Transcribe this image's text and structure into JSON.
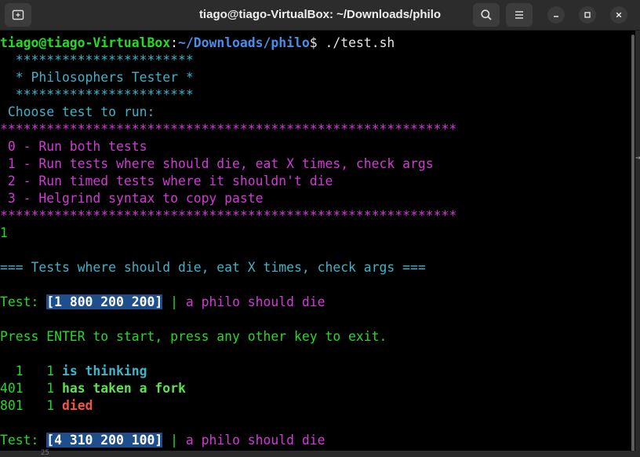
{
  "window": {
    "title": "tiago@tiago-VirtualBox: ~/Downloads/philo",
    "icons": {
      "new_tab": "new-tab-icon",
      "search": "search-icon",
      "menu": "hamburger-menu-icon",
      "minimize": "minimize-icon",
      "maximize": "maximize-icon",
      "close": "close-icon"
    }
  },
  "prompt": {
    "user_host": "tiago@tiago-VirtualBox",
    "colon": ":",
    "path": "~/Downloads/philo",
    "dollar": "$",
    "command": " ./test.sh"
  },
  "banner": {
    "stars": "  ***********************",
    "title": "  * Philosophers Tester *"
  },
  "menu": {
    "prompt": " Choose test to run:",
    "separator": "***********************************************************",
    "options": [
      " 0 - Run both tests",
      " 1 - Run tests where should die, eat X times, check args",
      " 2 - Run timed tests where it shouldn't die",
      " 3 - Helgrind syntax to copy paste"
    ]
  },
  "input": "1",
  "section_header": "=== Tests where should die, eat X times, check args ===",
  "tests": [
    {
      "prefix": "Test: ",
      "args": "[1 800 200 200]",
      "sep": " | ",
      "desc": "a philo should die"
    },
    {
      "prefix": "Test: ",
      "args": "[4 310 200 100]",
      "sep": " | ",
      "desc": "a philo should die"
    }
  ],
  "press_enter": "Press ENTER to start, press any other key to exit.",
  "log": [
    {
      "time": "  1",
      "philo": "   1 ",
      "action": "is thinking"
    },
    {
      "time": "401",
      "philo": "   1 ",
      "action": "has taken a fork"
    },
    {
      "time": "801",
      "philo": "   1 ",
      "action": "died"
    }
  ],
  "edge": {
    "right_glyph": "→",
    "bottom_number": "25"
  },
  "colors": {
    "prompt_user": "#26d926",
    "prompt_path": "#4a8de8",
    "cyan": "#3fb3c8",
    "magenta": "#d23ad6",
    "highlight_bg": "#1e4e8c",
    "died": "#f0563f",
    "fork": "#5fe04f",
    "background": "#000000"
  }
}
